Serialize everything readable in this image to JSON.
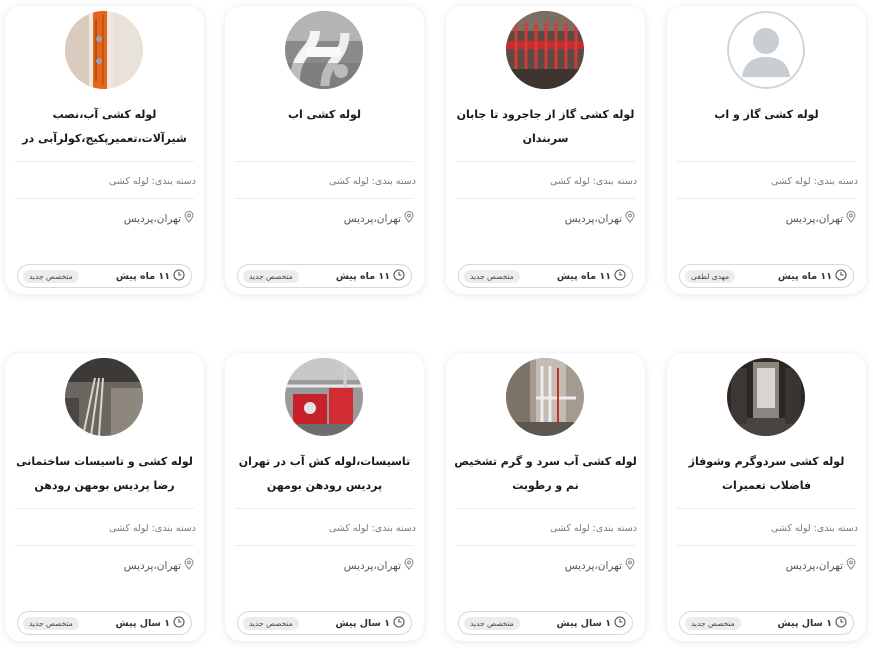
{
  "listings": [
    {
      "title": "لوله کشی آب،نصب شیرآلات،تعمیرپکیج،کولرآبی در پردیس",
      "category": "دسته بندی: لوله کشی",
      "location": "تهران،پردیس",
      "time": "۱۱ ماه پیش",
      "badge": "متخصص جدید",
      "image": "pipe-wall-photo"
    },
    {
      "title": "لوله کشی اب",
      "category": "دسته بندی: لوله کشی",
      "location": "تهران،پردیس",
      "time": "۱۱ ماه پیش",
      "badge": "متخصص جدید",
      "image": "white-pipes-photo"
    },
    {
      "title": "لوله کشی گاز از جاجرود تا جابان سربندان",
      "category": "دسته بندی: لوله کشی",
      "location": "تهران،پردیس",
      "time": "۱۱ ماه پیش",
      "badge": "متخصص جدید",
      "image": "red-manifold-photo"
    },
    {
      "title": "لوله کشی گاز و اب",
      "category": "دسته بندی: لوله کشی",
      "location": "تهران،پردیس",
      "time": "۱۱ ماه پیش",
      "badge": "مهدی لطفی",
      "image": "default-user-avatar"
    },
    {
      "title": "لوله کشی و تاسیسات ساختمانی رضا پردیس بومهن رودهن",
      "category": "دسته بندی: لوله کشی",
      "location": "تهران،پردیس",
      "time": "۱ سال پیش",
      "badge": "متخصص جدید",
      "image": "floor-pipes-photo"
    },
    {
      "title": "تاسیسات،لوله کش آب در تهران پردیس رودهن بومهن",
      "category": "دسته بندی: لوله کشی",
      "location": "تهران،پردیس",
      "time": "۱ سال پیش",
      "badge": "متخصص جدید",
      "image": "boiler-room-photo"
    },
    {
      "title": "لوله کشی آب سرد و گرم تشخیص نم و رطوبت",
      "category": "دسته بندی: لوله کشی",
      "location": "تهران،پردیس",
      "time": "۱ سال پیش",
      "badge": "متخصص جدید",
      "image": "wall-plumbing-photo"
    },
    {
      "title": "لوله کشی سردوگرم وشوفاژ فاضلاب تعمیرات",
      "category": "دسته بندی: لوله کشی",
      "location": "تهران،پردیس",
      "time": "۱ سال پیش",
      "badge": "متخصص جدید",
      "image": "bathroom-photo"
    }
  ],
  "icons": {
    "location": "map-pin-icon",
    "time": "clock-icon"
  }
}
